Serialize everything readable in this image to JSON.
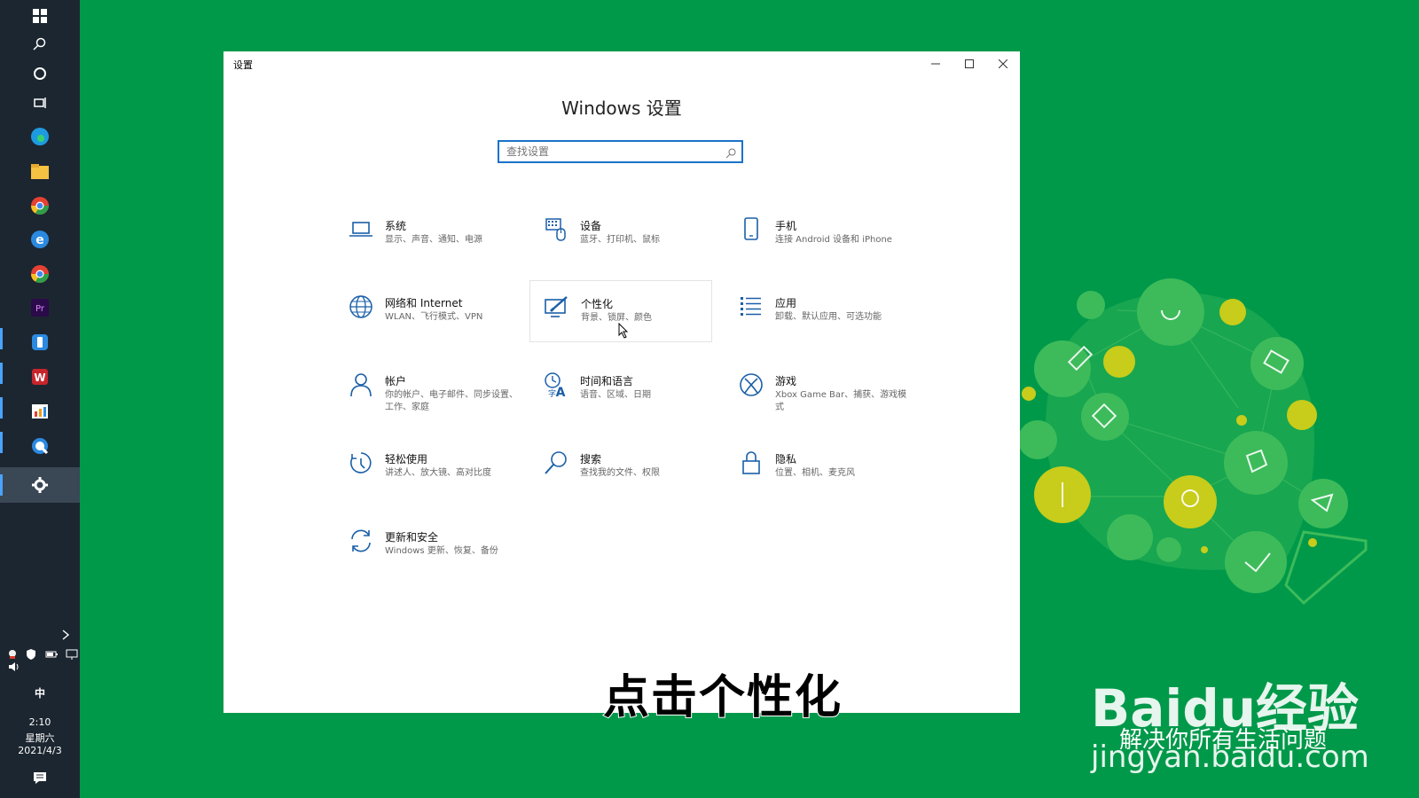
{
  "window": {
    "title": "设置",
    "heading": "Windows 设置",
    "search_placeholder": "查找设置"
  },
  "tiles": [
    {
      "name": "系统",
      "desc": "显示、声音、通知、电源",
      "icon": "laptop-icon"
    },
    {
      "name": "设备",
      "desc": "蓝牙、打印机、鼠标",
      "icon": "keyboard-device-icon"
    },
    {
      "name": "手机",
      "desc": "连接 Android 设备和 iPhone",
      "icon": "phone-icon"
    },
    {
      "name": "网络和 Internet",
      "desc": "WLAN、飞行模式、VPN",
      "icon": "globe-icon"
    },
    {
      "name": "个性化",
      "desc": "背景、锁屏、颜色",
      "icon": "paint-screen-icon"
    },
    {
      "name": "应用",
      "desc": "卸载、默认应用、可选功能",
      "icon": "apps-list-icon"
    },
    {
      "name": "帐户",
      "desc": "你的帐户、电子邮件、同步设置、工作、家庭",
      "icon": "person-icon"
    },
    {
      "name": "时间和语言",
      "desc": "语音、区域、日期",
      "icon": "time-language-icon"
    },
    {
      "name": "游戏",
      "desc": "Xbox Game Bar、捕获、游戏模式",
      "icon": "xbox-icon"
    },
    {
      "name": "轻松使用",
      "desc": "讲述人、放大镜、高对比度",
      "icon": "ease-of-access-icon"
    },
    {
      "name": "搜索",
      "desc": "查找我的文件、权限",
      "icon": "search-icon"
    },
    {
      "name": "隐私",
      "desc": "位置、相机、麦克风",
      "icon": "lock-icon"
    },
    {
      "name": "更新和安全",
      "desc": "Windows 更新、恢复、备份",
      "icon": "update-arrows-icon"
    }
  ],
  "tray": {
    "ime": "中",
    "time": "2:10",
    "weekday": "星期六",
    "date": "2021/4/3"
  },
  "subtitle": "点击个性化",
  "watermark": {
    "brand": "Baidu经验",
    "slogan": "解决你所有生活问题",
    "url": "jingyan.baidu.com"
  },
  "colors": {
    "background": "#00994a",
    "taskbar": "#1c2630",
    "accent": "#1a73c9"
  }
}
